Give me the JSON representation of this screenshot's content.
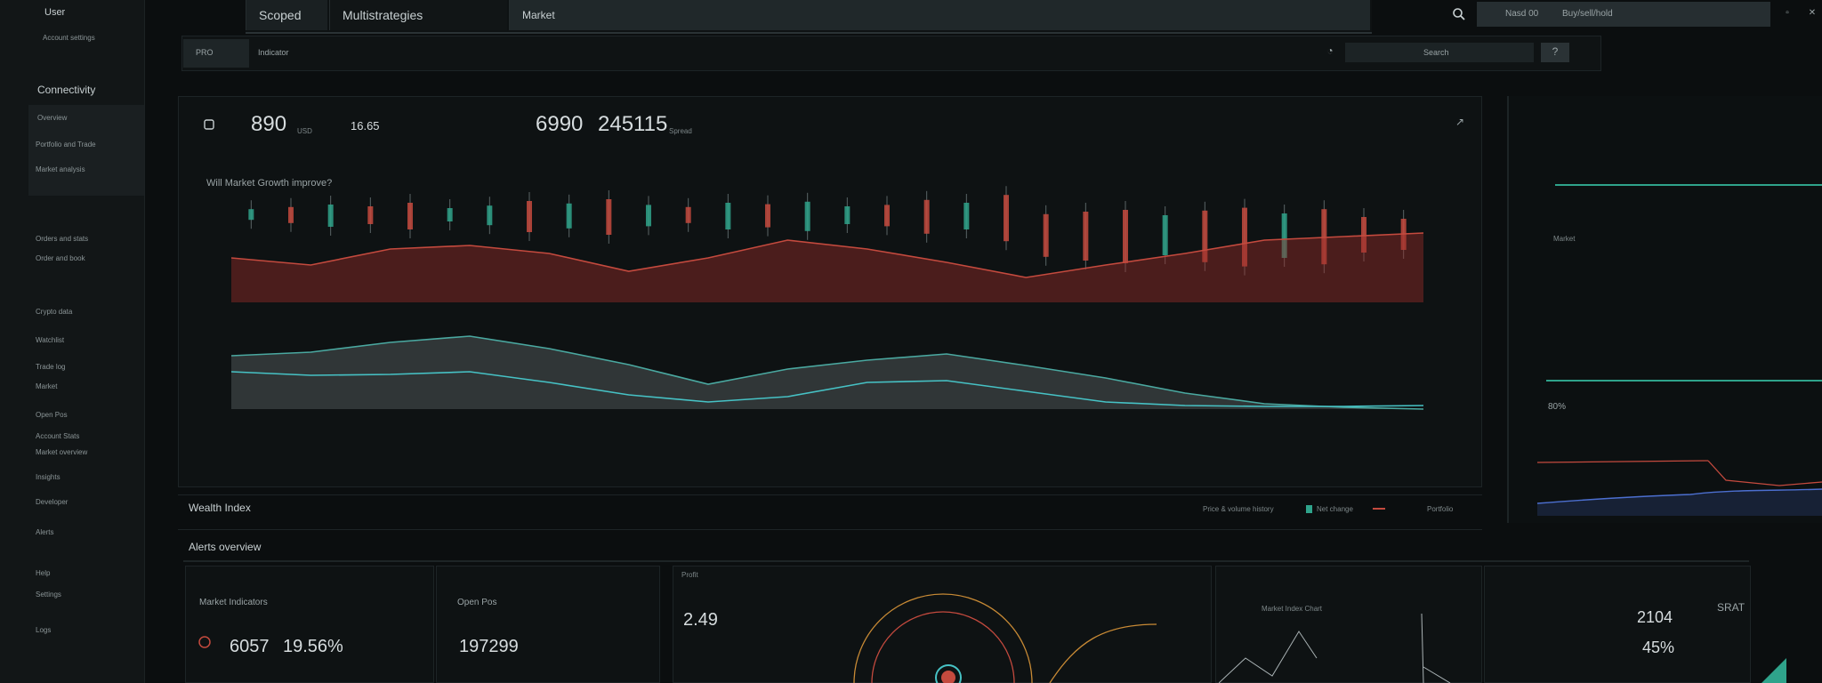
{
  "sidebar": {
    "user": "User",
    "user_sub": "Account settings",
    "section_title": "Connectivity",
    "items": [
      "Overview",
      "Portfolio and Trade",
      "Market analysis",
      "Orders and stats",
      "Order and book",
      "Crypto data",
      "Watchlist",
      "Trade log",
      "Market",
      "Open Pos",
      "Account Stats",
      "Market overview",
      "Insights",
      "Developer",
      "Alerts",
      "Help",
      "Settings",
      "Logs"
    ]
  },
  "topbar": {
    "tab1": "Scoped",
    "tab2": "Multistrategies",
    "tab3": "Market",
    "search_placeholder": "Search",
    "right_label_1": "Nasd 00",
    "right_label_2": "Buy/sell/hold"
  },
  "subbar": {
    "left_button": "PRO",
    "left_text": "Indicator",
    "right_field": "Search"
  },
  "main_chart": {
    "stat1": "890",
    "stat1_sub": "USD",
    "stat2": "16.65",
    "stat3": "6990",
    "stat4": "245115",
    "stat4_sub": "Spread",
    "title": "Will Market Growth improve?",
    "footer_title": "Wealth Index",
    "legend_label": "Price & volume history",
    "legend_item_1": "Net change",
    "legend_item_2": "Portfolio"
  },
  "chart_data": {
    "type": "line",
    "series": [
      {
        "values": [
          210,
          218,
          200,
          196,
          205,
          225,
          210,
          190,
          200,
          215,
          232,
          218,
          205,
          190,
          186,
          182
        ]
      },
      {
        "values": [
          320,
          316,
          305,
          298,
          312,
          330,
          352,
          335,
          325,
          318,
          331,
          345,
          362,
          374,
          378,
          380
        ]
      },
      {
        "values": [
          338,
          342,
          341,
          338,
          350,
          364,
          372,
          366,
          350,
          348,
          360,
          372,
          376,
          377,
          377,
          376
        ]
      }
    ],
    "candles": [
      {
        "v": 12,
        "dir": "up"
      },
      {
        "v": 18,
        "dir": "down"
      },
      {
        "v": 25,
        "dir": "up"
      },
      {
        "v": 20,
        "dir": "down"
      },
      {
        "v": 30,
        "dir": "down"
      },
      {
        "v": 15,
        "dir": "up"
      },
      {
        "v": 22,
        "dir": "up"
      },
      {
        "v": 35,
        "dir": "down"
      },
      {
        "v": 28,
        "dir": "up"
      },
      {
        "v": 40,
        "dir": "down"
      },
      {
        "v": 24,
        "dir": "up"
      },
      {
        "v": 18,
        "dir": "down"
      },
      {
        "v": 30,
        "dir": "up"
      },
      {
        "v": 26,
        "dir": "down"
      },
      {
        "v": 33,
        "dir": "up"
      },
      {
        "v": 20,
        "dir": "up"
      },
      {
        "v": 24,
        "dir": "down"
      },
      {
        "v": 38,
        "dir": "down"
      },
      {
        "v": 30,
        "dir": "up"
      },
      {
        "v": 52,
        "dir": "down"
      },
      {
        "v": 48,
        "dir": "down"
      },
      {
        "v": 55,
        "dir": "down"
      },
      {
        "v": 60,
        "dir": "down"
      },
      {
        "v": 45,
        "dir": "up"
      },
      {
        "v": 58,
        "dir": "down"
      },
      {
        "v": 66,
        "dir": "down"
      },
      {
        "v": 50,
        "dir": "up"
      },
      {
        "v": 62,
        "dir": "down"
      },
      {
        "v": 40,
        "dir": "down"
      },
      {
        "v": 35,
        "dir": "down"
      }
    ]
  },
  "right_panel": {
    "value": "80%",
    "label": "Market"
  },
  "bottom": {
    "section_title": "Alerts overview",
    "card1_title": "Market Indicators",
    "card1_value": "6057",
    "card1_value2": "19.56%",
    "card2_title": "Open Pos",
    "card2_value": "197299",
    "card3_title": "Profit",
    "card3_value": "2.49",
    "card4_title": "Market Index Chart",
    "card5_value": "2104",
    "card5_value2": "45%",
    "card5_label": "SRAT"
  },
  "colors": {
    "accent_red": "#c44a3e",
    "accent_teal": "#2fa38b",
    "accent_cyan": "#46c2c5"
  }
}
